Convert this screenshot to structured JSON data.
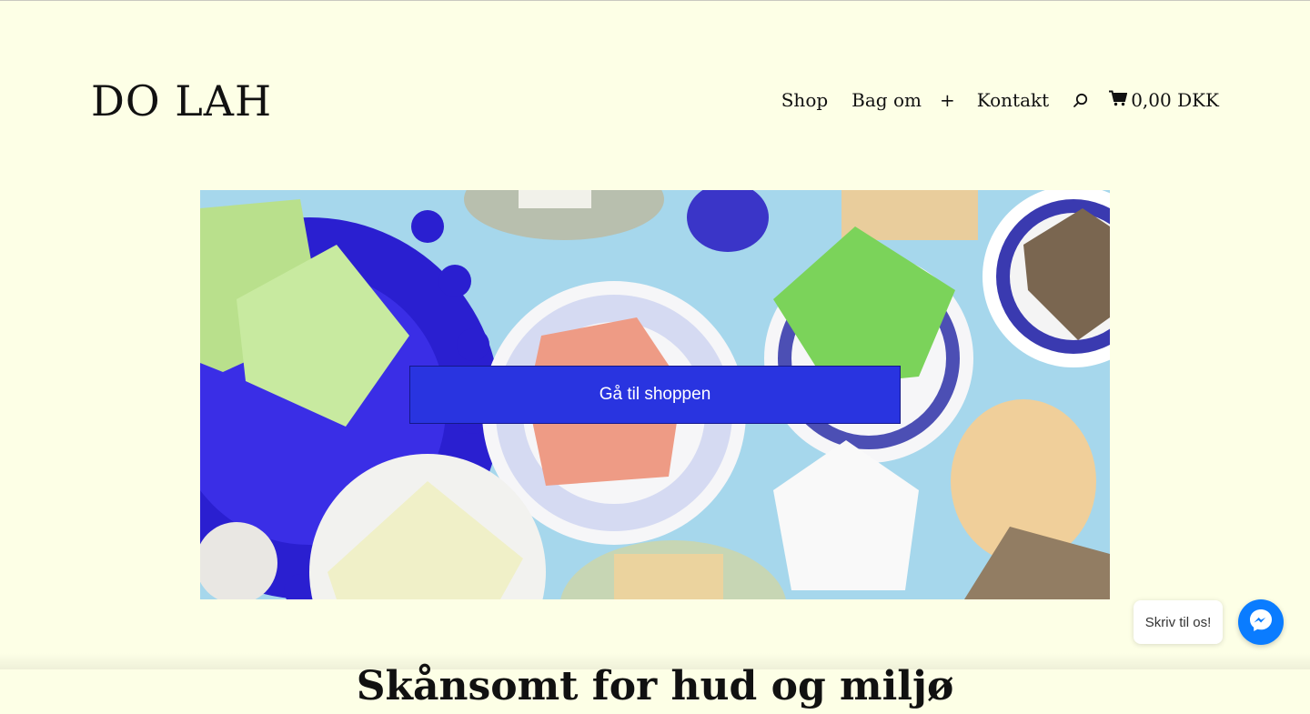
{
  "brand": {
    "logo_text": "DO LAH"
  },
  "nav": {
    "items": [
      {
        "label": "Shop"
      },
      {
        "label": "Bag om"
      },
      {
        "label": "+"
      },
      {
        "label": "Kontakt"
      }
    ],
    "search_icon": "search-icon",
    "cart_icon": "cart-icon",
    "cart_total": "0,00 DKK"
  },
  "hero": {
    "cta_label": "Gå til shoppen",
    "cta_color": "#2934e0"
  },
  "main": {
    "headline": "Skånsomt for hud og miljø"
  },
  "chat": {
    "bubble_text": "Skriv til os!",
    "icon": "messenger-icon",
    "color": "#0a7cff"
  },
  "colors": {
    "background": "#fdffe6",
    "text": "#111111"
  }
}
